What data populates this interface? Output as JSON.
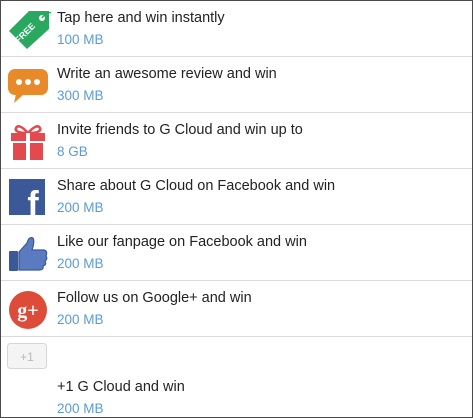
{
  "offers": [
    {
      "icon": "free-tag-icon",
      "title": "Tap here and win instantly",
      "reward": "100 MB",
      "badge": "FREE"
    },
    {
      "icon": "chat-bubble-icon",
      "title": "Write an awesome review and win",
      "reward": "300 MB"
    },
    {
      "icon": "gift-icon",
      "title": "Invite friends to G Cloud and win up to",
      "reward": "8 GB"
    },
    {
      "icon": "facebook-icon",
      "title": "Share about G Cloud on Facebook and win",
      "reward": "200 MB",
      "glyph": "f"
    },
    {
      "icon": "thumbs-up-icon",
      "title": "Like our fanpage on Facebook and win",
      "reward": "200 MB"
    },
    {
      "icon": "google-plus-icon",
      "title": "Follow us on Google+ and win",
      "reward": "200 MB",
      "glyph": "g+"
    },
    {
      "icon": "plus-one-icon",
      "title": "+1 G Cloud and win",
      "reward": "200 MB",
      "glyph": "+1"
    }
  ],
  "colors": {
    "reward_text": "#5b9bd5",
    "title_text": "#222222",
    "free_tag": "#2aa860",
    "chat_bubble": "#e8892a",
    "gift": "#e34a4f",
    "facebook": "#3b5998",
    "google_plus": "#dd4b39"
  }
}
